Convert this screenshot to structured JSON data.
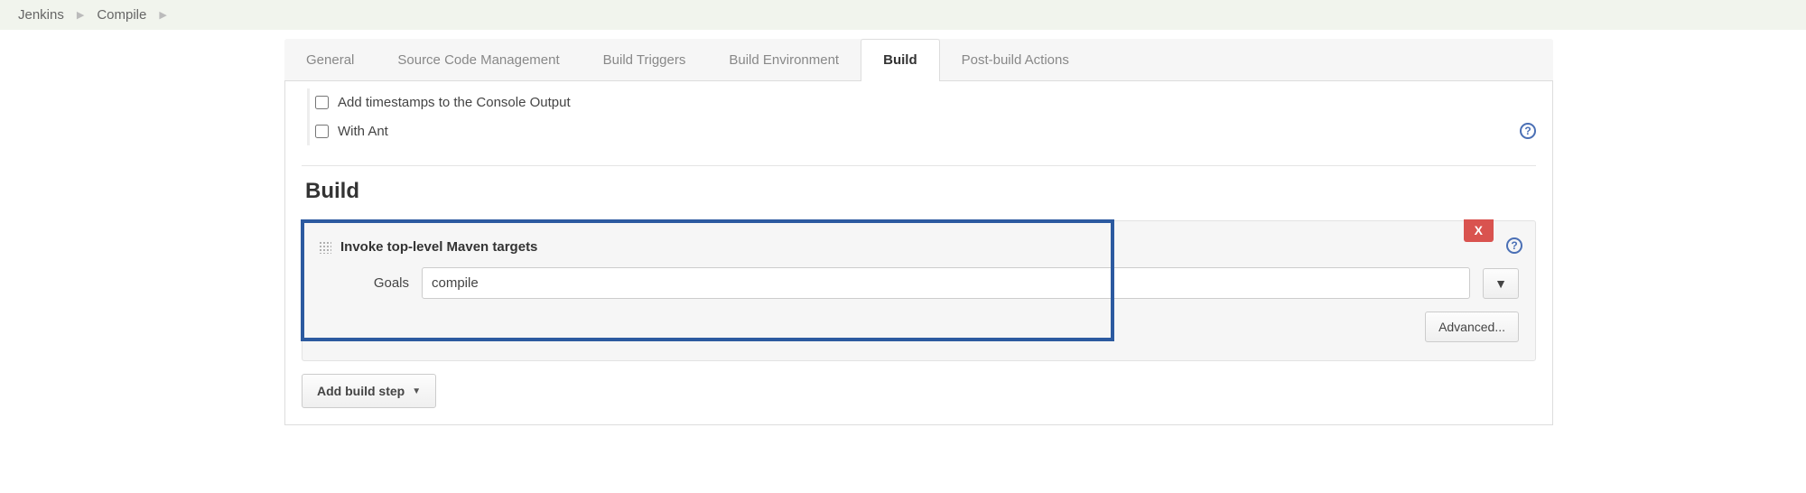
{
  "breadcrumbs": {
    "items": [
      "Jenkins",
      "Compile"
    ]
  },
  "tabs": {
    "items": [
      {
        "label": "General",
        "active": false
      },
      {
        "label": "Source Code Management",
        "active": false
      },
      {
        "label": "Build Triggers",
        "active": false
      },
      {
        "label": "Build Environment",
        "active": false
      },
      {
        "label": "Build",
        "active": true
      },
      {
        "label": "Post-build Actions",
        "active": false
      }
    ]
  },
  "options": {
    "timestamps_label": "Add timestamps to the Console Output",
    "with_ant_label": "With Ant"
  },
  "section": {
    "title": "Build"
  },
  "build_step": {
    "title": "Invoke top-level Maven targets",
    "delete_label": "X",
    "goals_label": "Goals",
    "goals_value": "compile",
    "expand_label": "▼",
    "advanced_label": "Advanced..."
  },
  "add_step_label": "Add build step"
}
